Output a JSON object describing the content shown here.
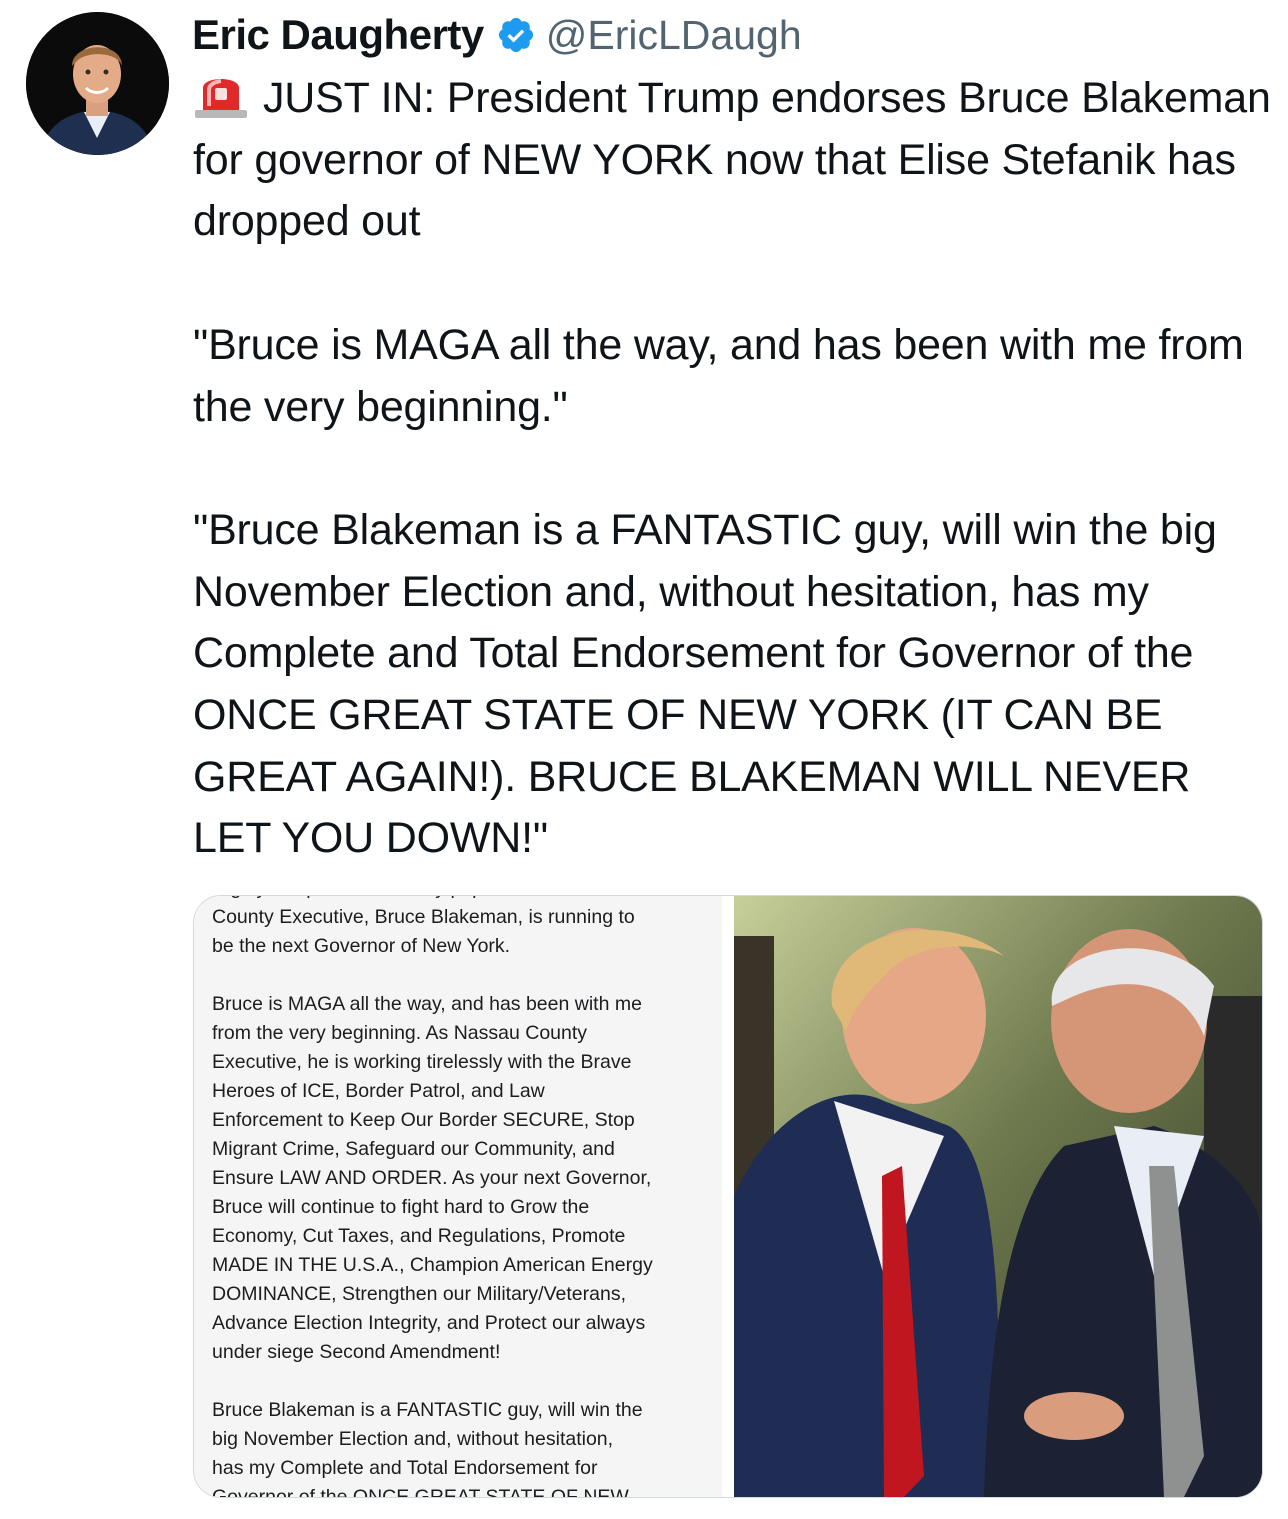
{
  "author": {
    "name": "Eric Daugherty",
    "handle": "@EricLDaugh",
    "verified": true
  },
  "tweet": {
    "text": "JUST IN: President Trump endorses Bruce Blakeman for governor of NEW YORK now that Elise Stefanik has dropped out\n\n\"Bruce is MAGA all the way, and has been with me from the very beginning.\"\n\n\"Bruce Blakeman is a FANTASTIC guy, will win the big November Election and, without hesitation, has my Complete and Total Endorsement for Governor of the ONCE GREAT STATE OF NEW YORK (IT CAN BE GREAT AGAIN!). BRUCE BLAKEMAN WILL NEVER LET YOU DOWN!\"",
    "leading_icon": "police-siren-emoji"
  },
  "screenshot_post": {
    "text": "Highly Respected and very popular Nassau\nCounty Executive, Bruce Blakeman, is running to\nbe the next Governor of New York.\n\nBruce is MAGA all the way, and has been with me\nfrom the very beginning. As Nassau County\nExecutive, he is working tirelessly with the Brave\nHeroes of ICE, Border Patrol, and Law\nEnforcement to Keep Our Border SECURE, Stop\nMigrant Crime, Safeguard our Community, and\nEnsure LAW AND ORDER. As your next Governor,\nBruce will continue to fight hard to Grow the\nEconomy, Cut Taxes, and Regulations, Promote\nMADE IN THE U.S.A., Champion American Energy\nDOMINANCE, Strengthen our Military/Veterans,\nAdvance Election Integrity, and Protect our always\nunder siege Second Amendment!\n\nBruce Blakeman is a FANTASTIC guy, will win the\nbig November Election and, without hesitation,\nhas my Complete and Total Endorsement for\nGovernor of the ONCE GREAT STATE OF NEW"
  },
  "photo": {
    "subject": "two-men-in-suits-talking"
  },
  "colors": {
    "verified_blue": "#1d9bf0",
    "handle_gray": "#536471",
    "text": "#0f1419",
    "tie_red": "#c0161f"
  }
}
